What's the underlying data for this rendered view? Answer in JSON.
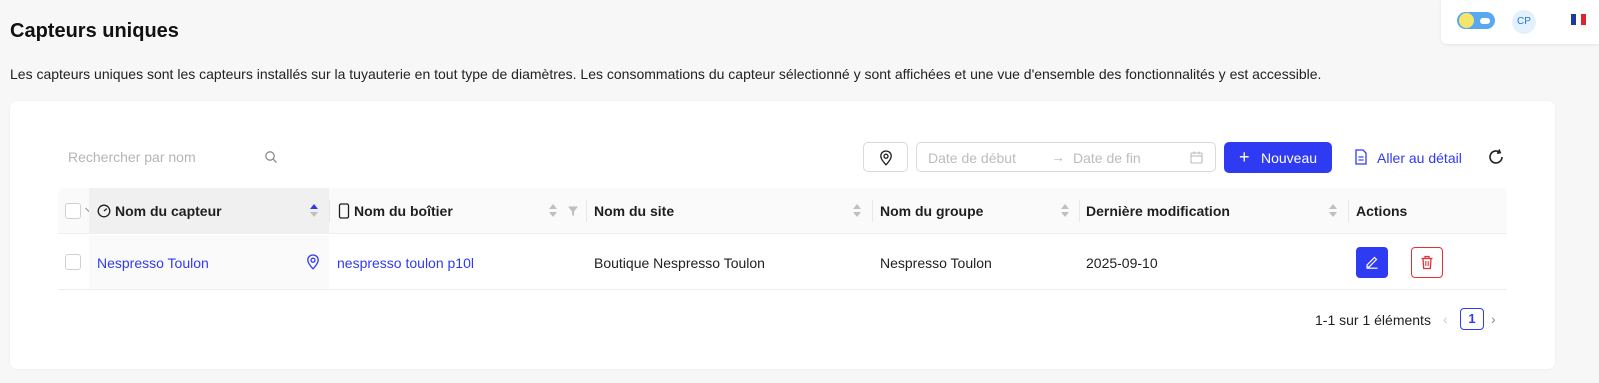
{
  "header": {
    "avatar_initials": "CP",
    "language_flag": "fr-flag-icon",
    "theme_toggle": "day-night-toggle"
  },
  "page": {
    "title": "Capteurs uniques",
    "description": "Les capteurs uniques sont les capteurs installés sur la tuyauterie en tout type de diamètres. Les consommations du capteur sélectionné y sont affichées et une vue d'ensemble des fonctionnalités y est accessible."
  },
  "toolbar": {
    "search_placeholder": "Rechercher par nom",
    "date_start_placeholder": "Date de début",
    "date_end_placeholder": "Date de fin",
    "date_separator": "→",
    "new_label": "Nouveau",
    "detail_label": "Aller au détail"
  },
  "table": {
    "columns": [
      "Nom du capteur",
      "Nom du boîtier",
      "Nom du site",
      "Nom du groupe",
      "Dernière modification",
      "Actions"
    ],
    "rows": [
      {
        "sensor": "Nespresso Toulon",
        "box": "nespresso toulon p10l",
        "site": "Boutique Nespresso Toulon",
        "group": "Nespresso Toulon",
        "modified": "2025-09-10"
      }
    ]
  },
  "pagination": {
    "summary": "1-1 sur 1 éléments",
    "current_page": "1",
    "prev": "‹",
    "next": "›"
  },
  "colors": {
    "primary": "#2f3bf2",
    "danger": "#e5303a"
  }
}
